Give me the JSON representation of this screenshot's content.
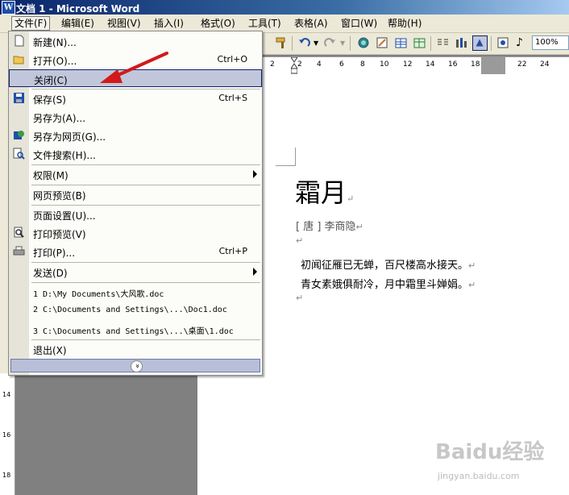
{
  "window": {
    "title": "文档 1 - Microsoft Word",
    "app_icon_letter": "W"
  },
  "menubar": [
    {
      "label": "文件(F)"
    },
    {
      "label": "编辑(E)"
    },
    {
      "label": "视图(V)"
    },
    {
      "label": "插入(I)"
    },
    {
      "label": "格式(O)"
    },
    {
      "label": "工具(T)"
    },
    {
      "label": "表格(A)"
    },
    {
      "label": "窗口(W)"
    },
    {
      "label": "帮助(H)"
    }
  ],
  "toolbar": {
    "zoom": "100%"
  },
  "ruler": {
    "numbers": [
      "2",
      "2",
      "4",
      "6",
      "8",
      "10",
      "12",
      "14",
      "16",
      "18",
      "22",
      "24"
    ]
  },
  "vruler": {
    "numbers": [
      "14",
      "16",
      "18"
    ]
  },
  "file_menu": {
    "items": [
      {
        "label": "新建(N)...",
        "shortcut": "",
        "icon": "new-doc-icon"
      },
      {
        "label": "打开(O)...",
        "shortcut": "Ctrl+O",
        "icon": "open-folder-icon"
      },
      {
        "label": "关闭(C)",
        "shortcut": "",
        "icon": ""
      },
      {
        "label": "保存(S)",
        "shortcut": "Ctrl+S",
        "icon": "save-icon"
      },
      {
        "label": "另存为(A)...",
        "shortcut": "",
        "icon": ""
      },
      {
        "label": "另存为网页(G)...",
        "shortcut": "",
        "icon": "save-web-icon"
      },
      {
        "label": "文件搜索(H)...",
        "shortcut": "",
        "icon": "file-search-icon"
      },
      {
        "label": "权限(M)",
        "shortcut": "",
        "icon": ""
      },
      {
        "label": "网页预览(B)",
        "shortcut": "",
        "icon": ""
      },
      {
        "label": "页面设置(U)...",
        "shortcut": "",
        "icon": ""
      },
      {
        "label": "打印预览(V)",
        "shortcut": "",
        "icon": "print-preview-icon"
      },
      {
        "label": "打印(P)...",
        "shortcut": "Ctrl+P",
        "icon": "print-icon"
      },
      {
        "label": "发送(D)",
        "shortcut": "",
        "icon": ""
      },
      {
        "label": "1 D:\\My Documents\\大风歌.doc",
        "shortcut": "",
        "icon": ""
      },
      {
        "label": "2 C:\\Documents and Settings\\...\\Doc1.doc",
        "shortcut": "",
        "icon": ""
      },
      {
        "label": "3 C:\\Documents and Settings\\...\\桌面\\1.doc",
        "shortcut": "",
        "icon": ""
      },
      {
        "label": "退出(X)",
        "shortcut": "",
        "icon": ""
      }
    ],
    "expand_glyph": "»"
  },
  "document": {
    "title": "霜月",
    "author": "[ 唐 ] 李商隐",
    "lines": [
      "初闻征雁已无蝉，百尺楼高水接天。",
      "青女素娥俱耐冷，月中霜里斗婵娟。"
    ],
    "para_mark": "↵"
  },
  "watermark": {
    "brand": "Baidu经验",
    "url": "jingyan.baidu.com"
  },
  "colors": {
    "highlight": "#c1c6da",
    "title_bar": "#0a246a",
    "arrow": "#d11a1a"
  }
}
